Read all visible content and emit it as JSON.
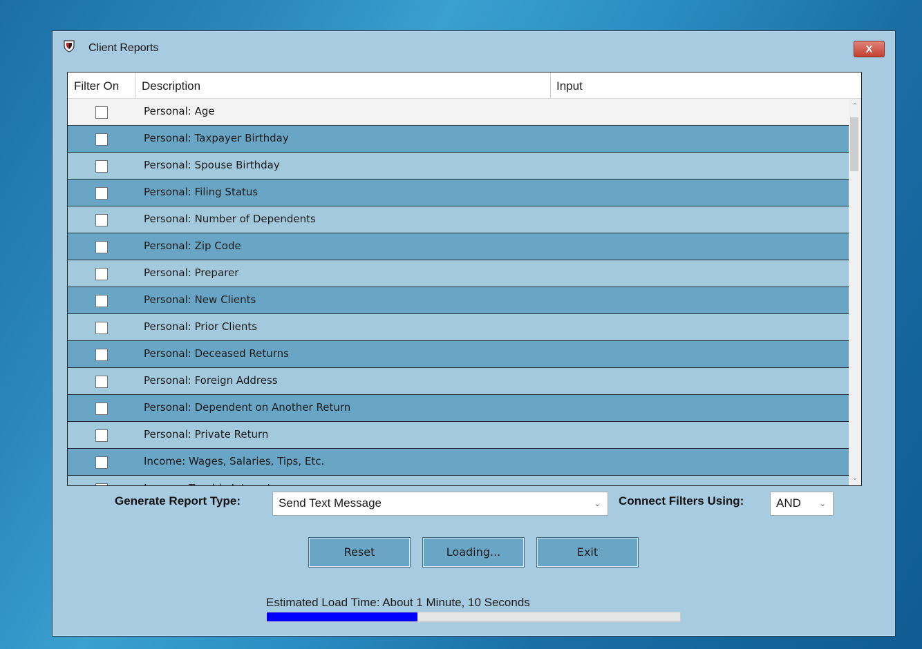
{
  "window": {
    "title": "Client Reports",
    "close_label": "X"
  },
  "grid": {
    "columns": [
      "Filter On",
      "Description",
      "Input"
    ],
    "rows": [
      {
        "label": "Personal: Age",
        "checked": false
      },
      {
        "label": "Personal: Taxpayer Birthday",
        "checked": false
      },
      {
        "label": "Personal: Spouse Birthday",
        "checked": false
      },
      {
        "label": "Personal: Filing Status",
        "checked": false
      },
      {
        "label": "Personal: Number of Dependents",
        "checked": false
      },
      {
        "label": "Personal: Zip Code",
        "checked": false
      },
      {
        "label": "Personal: Preparer",
        "checked": false
      },
      {
        "label": "Personal: New Clients",
        "checked": false
      },
      {
        "label": "Personal: Prior Clients",
        "checked": false
      },
      {
        "label": "Personal: Deceased Returns",
        "checked": false
      },
      {
        "label": "Personal: Foreign Address",
        "checked": false
      },
      {
        "label": "Personal: Dependent on Another Return",
        "checked": false
      },
      {
        "label": "Personal: Private Return",
        "checked": false
      },
      {
        "label": "Income: Wages, Salaries, Tips, Etc.",
        "checked": false
      },
      {
        "label": "Income: Taxable Interest",
        "checked": false
      }
    ]
  },
  "controls": {
    "report_type_label": "Generate Report Type:",
    "report_type_value": "Send Text Message",
    "connect_label": "Connect Filters Using:",
    "connect_value": "AND"
  },
  "buttons": {
    "reset": "Reset",
    "loading": "Loading...",
    "exit": "Exit"
  },
  "status": {
    "text": "Estimated Load Time: About 1 Minute, 10 Seconds",
    "progress_percent": 36.5
  },
  "colors": {
    "row_light": "#a3c9dd",
    "row_dark": "#69a6c6",
    "progress": "#0000ff"
  }
}
